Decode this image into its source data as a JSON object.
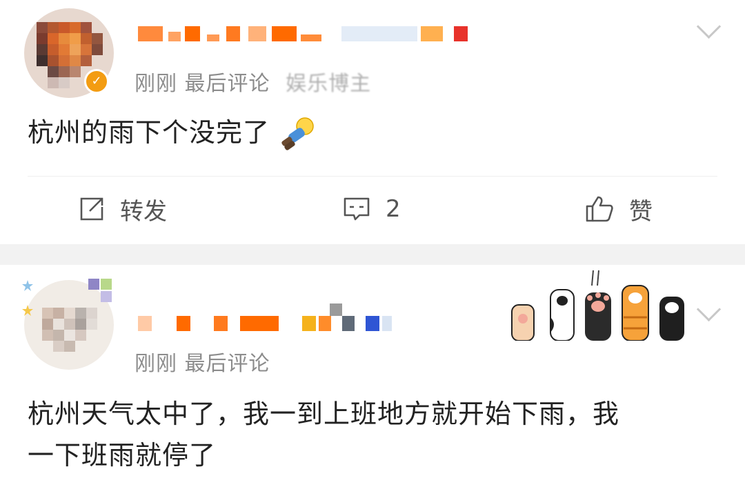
{
  "comments": [
    {
      "time": "刚刚",
      "label": "最后评论",
      "source": "娱乐博主",
      "content": "杭州的雨下个没完了",
      "actions": {
        "repost_label": "转发",
        "comment_count": "2",
        "like_label": "赞"
      }
    },
    {
      "time": "刚刚",
      "label": "最后评论",
      "content_line1": "杭州天气太中了，我一到上班地方就开始下雨，我",
      "content_line2": "一下班雨就停了"
    }
  ],
  "colors": {
    "accent_orange": "#f39c12",
    "name_orange": "#ff6a00",
    "meta_gray": "#8c8c8c",
    "separator": "#f2f2f2"
  },
  "icons": [
    "chevron-down-icon",
    "repost-icon",
    "comment-icon",
    "like-icon",
    "verified-badge-icon",
    "cat-paws-sticker"
  ]
}
